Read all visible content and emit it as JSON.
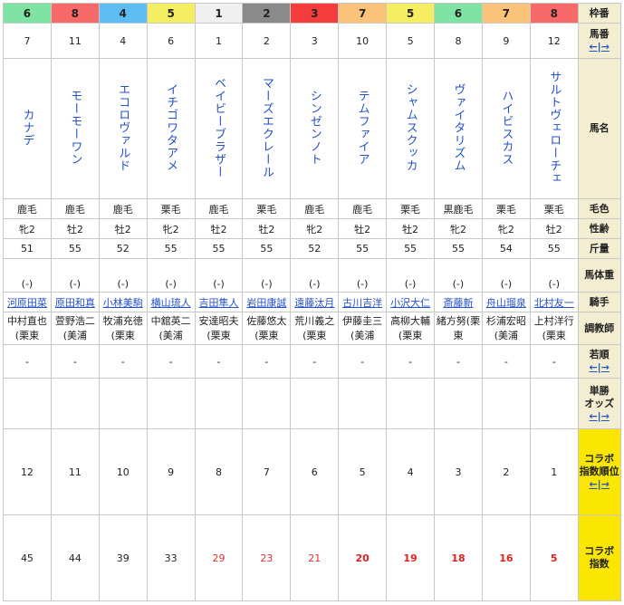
{
  "header": {
    "waku": "枠番",
    "umaban": "馬番",
    "bamei": "馬名",
    "keiro": "毛色",
    "seirei": "性齢",
    "kinryo": "斤量",
    "bataiju": "馬体重",
    "kishu": "騎手",
    "chokyoshi": "調教師",
    "wakajun": "若順",
    "tansho_line1": "単勝",
    "tansho_line2": "オッズ",
    "colabo_rank_line1": "コラボ",
    "colabo_rank_line2": "指数順位",
    "colabo_line1": "コラボ",
    "colabo_line2": "指数",
    "sort_left": "←",
    "sort_sep": "|",
    "sort_right": "→"
  },
  "horses": [
    {
      "waku": "6",
      "waku_bg": "#7fe3a3",
      "umaban": "7",
      "name": "カナデ",
      "keiro": "鹿毛",
      "seirei": "牝2",
      "kinryo": "51",
      "bataiju": "(-)",
      "jockey": "河原田菜",
      "trainer_l1": "中村直也",
      "trainer_l2": "(栗東",
      "wakajun": "-",
      "rank": "12",
      "index": "45",
      "index_style": "normal"
    },
    {
      "waku": "8",
      "waku_bg": "#f86a6a",
      "umaban": "11",
      "name": "モーモーワン",
      "keiro": "鹿毛",
      "seirei": "牡2",
      "kinryo": "55",
      "bataiju": "(-)",
      "jockey": "原田和真",
      "trainer_l1": "萱野浩二",
      "trainer_l2": "(美浦",
      "wakajun": "-",
      "rank": "11",
      "index": "44",
      "index_style": "normal"
    },
    {
      "waku": "4",
      "waku_bg": "#5dbdf2",
      "umaban": "4",
      "name": "エコロヴァルド",
      "keiro": "鹿毛",
      "seirei": "牡2",
      "kinryo": "52",
      "bataiju": "(-)",
      "jockey": "小林美駒",
      "trainer_l1": "牧浦充徳",
      "trainer_l2": "(栗東",
      "wakajun": "-",
      "rank": "10",
      "index": "39",
      "index_style": "normal"
    },
    {
      "waku": "5",
      "waku_bg": "#f4ee60",
      "umaban": "6",
      "name": "イチゴワタアメ",
      "keiro": "栗毛",
      "seirei": "牝2",
      "kinryo": "55",
      "bataiju": "(-)",
      "jockey": "横山琉人",
      "trainer_l1": "中舘英二",
      "trainer_l2": "(美浦",
      "wakajun": "-",
      "rank": "9",
      "index": "33",
      "index_style": "normal"
    },
    {
      "waku": "1",
      "waku_bg": "#f0f0f0",
      "umaban": "1",
      "name": "ベイビーブラザー",
      "keiro": "鹿毛",
      "seirei": "牡2",
      "kinryo": "55",
      "bataiju": "(-)",
      "jockey": "吉田隼人",
      "trainer_l1": "安達昭夫",
      "trainer_l2": "(栗東",
      "wakajun": "-",
      "rank": "8",
      "index": "29",
      "index_style": "red"
    },
    {
      "waku": "2",
      "waku_bg": "#8a8a8a",
      "umaban": "2",
      "name": "マーズエクレール",
      "keiro": "栗毛",
      "seirei": "牡2",
      "kinryo": "55",
      "bataiju": "(-)",
      "jockey": "岩田康誠",
      "trainer_l1": "佐藤悠太",
      "trainer_l2": "(栗東",
      "wakajun": "-",
      "rank": "7",
      "index": "23",
      "index_style": "red"
    },
    {
      "waku": "3",
      "waku_bg": "#f43c3c",
      "umaban": "3",
      "name": "シンゼンノト",
      "keiro": "鹿毛",
      "seirei": "牝2",
      "kinryo": "52",
      "bataiju": "(-)",
      "jockey": "遠藤汰月",
      "trainer_l1": "荒川義之",
      "trainer_l2": "(栗東",
      "wakajun": "-",
      "rank": "6",
      "index": "21",
      "index_style": "red"
    },
    {
      "waku": "7",
      "waku_bg": "#fbc37a",
      "umaban": "10",
      "name": "テムファイア",
      "keiro": "鹿毛",
      "seirei": "牡2",
      "kinryo": "55",
      "bataiju": "(-)",
      "jockey": "古川吉洋",
      "trainer_l1": "伊藤圭三",
      "trainer_l2": "(美浦",
      "wakajun": "-",
      "rank": "5",
      "index": "20",
      "index_style": "redbold"
    },
    {
      "waku": "5",
      "waku_bg": "#f4ee60",
      "umaban": "5",
      "name": "シャムスクッカ",
      "keiro": "栗毛",
      "seirei": "牡2",
      "kinryo": "55",
      "bataiju": "(-)",
      "jockey": "小沢大仁",
      "trainer_l1": "高柳大輔",
      "trainer_l2": "(栗東",
      "wakajun": "-",
      "rank": "4",
      "index": "19",
      "index_style": "redbold"
    },
    {
      "waku": "6",
      "waku_bg": "#7fe3a3",
      "umaban": "8",
      "name": "ヴァイタリズム",
      "keiro": "黒鹿毛",
      "seirei": "牝2",
      "kinryo": "55",
      "bataiju": "(-)",
      "jockey": "斎藤新",
      "trainer_l1": "緒方努(栗",
      "trainer_l2": "東",
      "wakajun": "-",
      "rank": "3",
      "index": "18",
      "index_style": "redbold"
    },
    {
      "waku": "7",
      "waku_bg": "#fbc37a",
      "umaban": "9",
      "name": "ハイビスカス",
      "keiro": "栗毛",
      "seirei": "牝2",
      "kinryo": "54",
      "bataiju": "(-)",
      "jockey": "舟山瑠泉",
      "trainer_l1": "杉浦宏昭",
      "trainer_l2": "(美浦",
      "wakajun": "-",
      "rank": "2",
      "index": "16",
      "index_style": "redbold"
    },
    {
      "waku": "8",
      "waku_bg": "#f86a6a",
      "umaban": "12",
      "name": "サルトヴェローチェ",
      "keiro": "栗毛",
      "seirei": "牡2",
      "kinryo": "55",
      "bataiju": "(-)",
      "jockey": "北村友一",
      "trainer_l1": "上村洋行",
      "trainer_l2": "(栗東",
      "wakajun": "-",
      "rank": "1",
      "index": "5",
      "index_style": "redbold"
    }
  ]
}
